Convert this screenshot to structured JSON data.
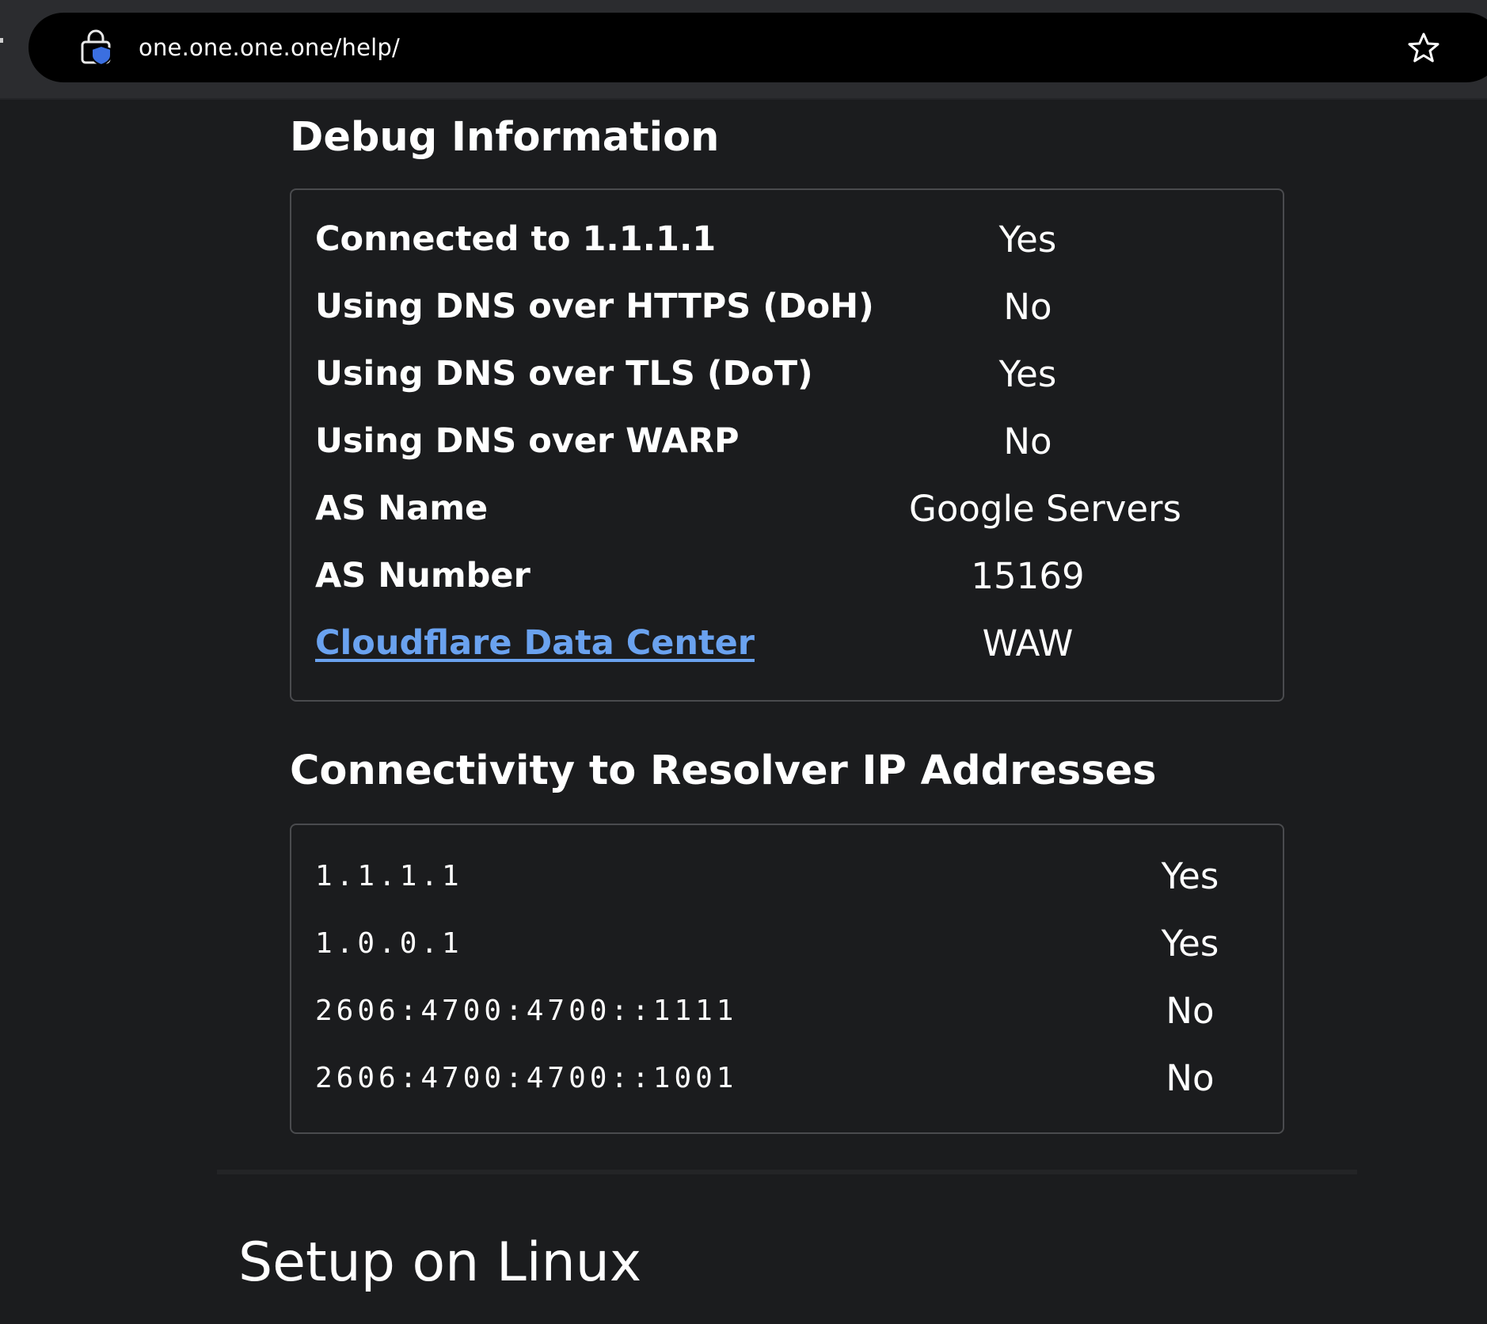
{
  "browser": {
    "url": "one.one.one.one/help/"
  },
  "debug": {
    "title": "Debug Information",
    "rows": [
      {
        "label": "Connected to 1.1.1.1",
        "value": "Yes"
      },
      {
        "label": "Using DNS over HTTPS (DoH)",
        "value": "No"
      },
      {
        "label": "Using DNS over TLS (DoT)",
        "value": "Yes"
      },
      {
        "label": "Using DNS over WARP",
        "value": "No"
      },
      {
        "label": "AS Name",
        "value": "Google Servers"
      },
      {
        "label": "AS Number",
        "value": "15169"
      },
      {
        "label": "Cloudflare Data Center",
        "value": "WAW"
      }
    ]
  },
  "connectivity": {
    "title": "Connectivity to Resolver IP Addresses",
    "rows": [
      {
        "ip": "1.1.1.1",
        "status": "Yes"
      },
      {
        "ip": "1.0.0.1",
        "status": "Yes"
      },
      {
        "ip": "2606:4700:4700::1111",
        "status": "No"
      },
      {
        "ip": "2606:4700:4700::1001",
        "status": "No"
      }
    ]
  },
  "linux": {
    "title": "Setup on Linux"
  },
  "colors": {
    "background": "#1b1c1e",
    "link": "#6aa2ef",
    "card_border": "#4a4b4e",
    "shield": "#3b6fe0"
  }
}
